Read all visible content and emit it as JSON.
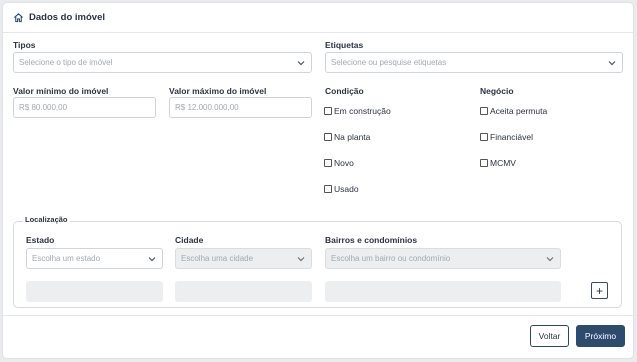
{
  "header": {
    "title": "Dados do imóvel",
    "icon": "home-icon"
  },
  "tipos": {
    "label": "Tipos",
    "placeholder": "Selecione o tipo de imóvel"
  },
  "etiquetas": {
    "label": "Etiquetas",
    "placeholder": "Selecione ou pesquise etiquetas"
  },
  "valor_minimo": {
    "label": "Valor mínimo do imóvel",
    "placeholder": "R$ 80.000,00"
  },
  "valor_maximo": {
    "label": "Valor máximo do imóvel",
    "placeholder": "R$ 12.000.000,00"
  },
  "condicao": {
    "label": "Condição",
    "options": [
      "Em construção",
      "Na planta",
      "Novo",
      "Usado"
    ]
  },
  "negocio": {
    "label": "Negócio",
    "options": [
      "Aceita permuta",
      "Financiável",
      "MCMV"
    ]
  },
  "localizacao": {
    "legend": "Localização",
    "estado": {
      "label": "Estado",
      "placeholder": "Escolha um estado"
    },
    "cidade": {
      "label": "Cidade",
      "placeholder": "Escolha uma cidade"
    },
    "bairros": {
      "label": "Bairros e condomínios",
      "placeholder": "Escolha um bairro ou condomínio"
    },
    "add_label": "+"
  },
  "footer": {
    "back_label": "Voltar",
    "next_label": "Próximo"
  },
  "colors": {
    "primary": "#2e4a6e",
    "disabled_bg": "#eceef0",
    "border": "#cfd4da"
  }
}
